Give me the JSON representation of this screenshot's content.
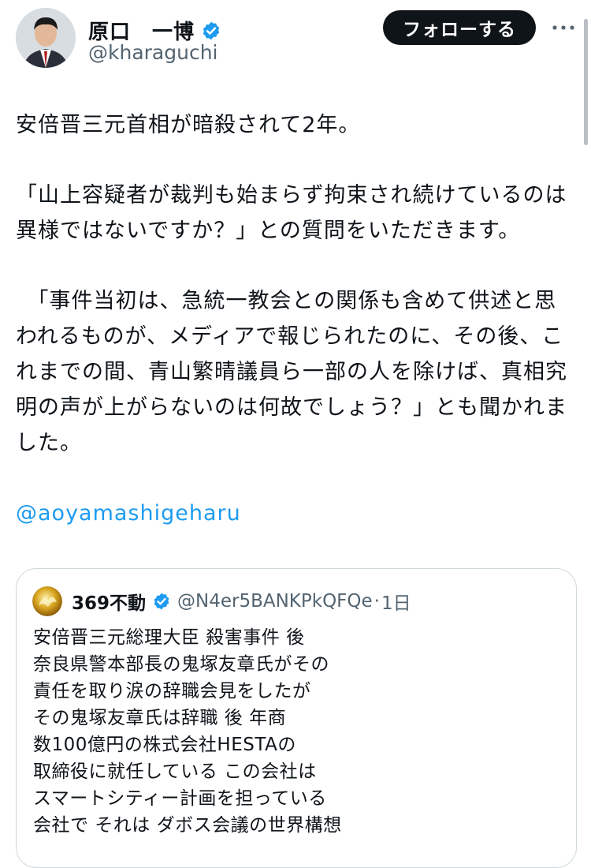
{
  "author": {
    "name": "原口　一博",
    "handle": "@kharaguchi",
    "verified": true,
    "follow_label": "フォローする",
    "more_icon": "more-horizontal-icon"
  },
  "tweet": {
    "paragraphs": [
      "安倍晋三元首相が暗殺されて2年。",
      "「山上容疑者が裁判も始まらず拘束され続けているのは異様ではないですか？」との質問をいただきます。",
      "　「事件当初は、急統一教会との関係も含めて供述と思われるものが、メディアで報じられたのに、その後、これまでの間、青山繁晴議員ら一部の人を除けば、真相究明の声が上がらないのは何故でしょう？」とも聞かれました。"
    ],
    "mention": "@aoyamashigeharu"
  },
  "quote": {
    "name": "369不動",
    "verified": true,
    "handle": "@N4er5BANKPkQFQe",
    "time": "1日",
    "lines": [
      "安倍晋三元総理大臣 殺害事件 後",
      "奈良県警本部長の鬼塚友章氏がその",
      "責任を取り涙の辞職会見をしたが",
      "その鬼塚友章氏は辞職 後 年商",
      "数100億円の株式会社HESTAの",
      "取締役に就任している この会社は",
      "スマートシティー計画を担っている",
      "会社で それは ダボス会議の世界構想"
    ]
  },
  "colors": {
    "text": "#0f1419",
    "secondary": "#536471",
    "link": "#1d9bf0",
    "verified": "#1d9bf0",
    "button_bg": "#0f1419",
    "border": "#cfd9de"
  }
}
